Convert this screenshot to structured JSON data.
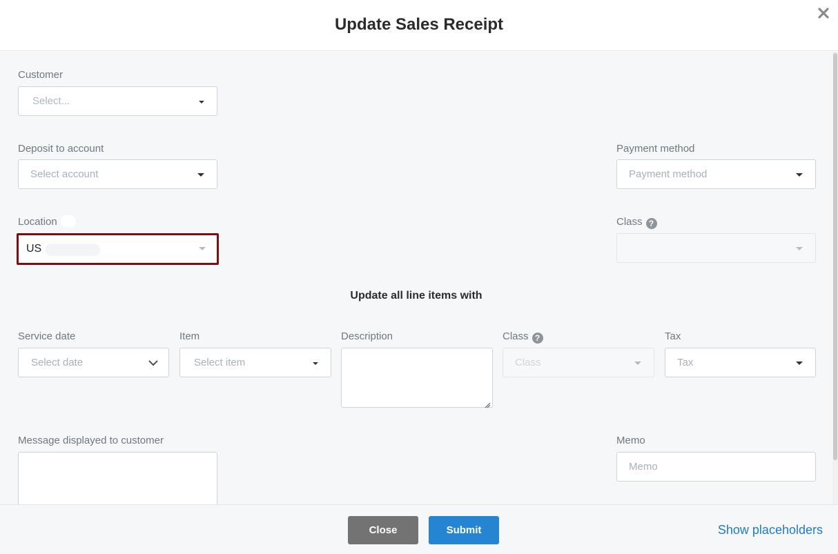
{
  "modal": {
    "title": "Update Sales Receipt"
  },
  "form": {
    "customer": {
      "label": "Customer",
      "placeholder": "Select..."
    },
    "deposit_account": {
      "label": "Deposit to account",
      "placeholder": "Select account"
    },
    "payment_method": {
      "label": "Payment method",
      "placeholder": "Payment method"
    },
    "location": {
      "label": "Location",
      "value": "US"
    },
    "class_top": {
      "label": "Class",
      "value": ""
    },
    "section_heading": "Update all line items with",
    "service_date": {
      "label": "Service date",
      "placeholder": "Select date"
    },
    "item": {
      "label": "Item",
      "placeholder": "Select item"
    },
    "description": {
      "label": "Description"
    },
    "class_line": {
      "label": "Class",
      "placeholder": "Class"
    },
    "tax": {
      "label": "Tax",
      "placeholder": "Tax"
    },
    "message": {
      "label": "Message displayed to customer"
    },
    "memo": {
      "label": "Memo",
      "placeholder": "Memo"
    }
  },
  "footer": {
    "close_label": "Close",
    "submit_label": "Submit",
    "show_placeholders_label": "Show placeholders"
  },
  "colors": {
    "highlight_border": "#7a0e10",
    "submit_bg": "#2585d2",
    "close_bg": "#737373",
    "link": "#1f7bc7"
  },
  "icons": {
    "close": "close-icon",
    "help": "question-circle-icon",
    "dropdown": "caret-down-icon",
    "date": "chevron-down-icon"
  }
}
